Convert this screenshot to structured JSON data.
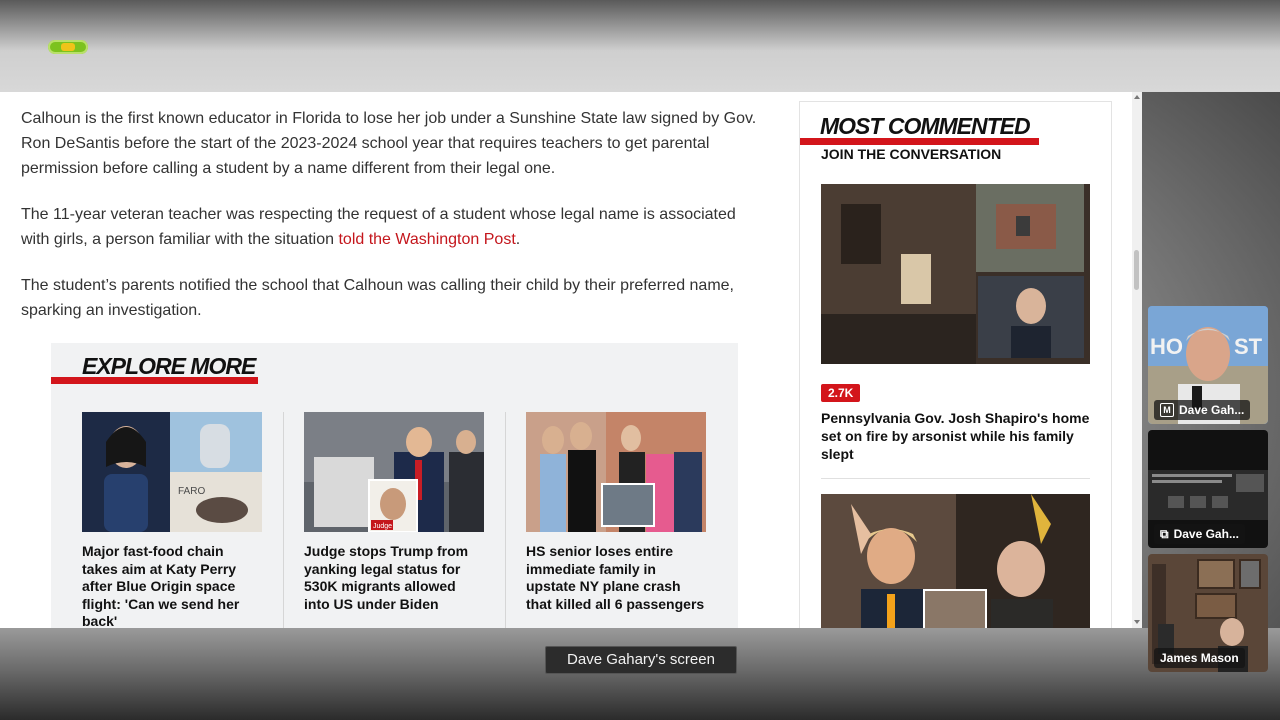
{
  "article": {
    "paragraph_1": "Calhoun is the first known educator in Florida to lose her job under a Sunshine State law signed by Gov. Ron DeSantis before the start of the 2023-2024 school year that requires teachers to get parental permission before calling a student by a name different from their legal one.",
    "paragraph_2_pre": "The 11-year veteran teacher was respecting the request of a student whose legal name is associated with girls, a person familiar with the situation ",
    "paragraph_2_link": "told the Washington Post",
    "paragraph_2_post": ".",
    "paragraph_3": "The student’s parents notified the school that Calhoun was calling their child by their preferred name, sparking an investigation."
  },
  "explore": {
    "title": "EXPLORE MORE",
    "cards": [
      {
        "headline": "Major fast-food chain takes aim at Katy Perry after Blue Origin space flight: 'Can we send her back'",
        "image_caption": "FARO"
      },
      {
        "headline": "Judge stops Trump from yanking legal status for 530K migrants allowed into US under Biden",
        "image_caption": "Judge"
      },
      {
        "headline": "HS senior loses entire immediate family in upstate NY plane crash that killed all 6 passengers",
        "image_caption": ""
      }
    ]
  },
  "sidebar": {
    "title": "MOST COMMENTED",
    "subtitle": "JOIN THE CONVERSATION",
    "stories": [
      {
        "comment_count": "2.7K",
        "headline": "Pennsylvania Gov. Josh Shapiro's home set on fire by arsonist while his family slept"
      }
    ]
  },
  "participants": [
    {
      "name": "Dave Gah...",
      "badge": "M",
      "icon": "mic-muted-icon",
      "active": true
    },
    {
      "name": "Dave Gah...",
      "badge": "",
      "icon": "screen-share-icon",
      "active": false
    },
    {
      "name": "James Mason",
      "badge": "",
      "icon": "",
      "active": false
    }
  ],
  "screen_label": "Dave Gahary's screen",
  "colors": {
    "accent_red": "#d3151b",
    "link_red": "#c4161c",
    "active_border": "#3d8bfd"
  }
}
